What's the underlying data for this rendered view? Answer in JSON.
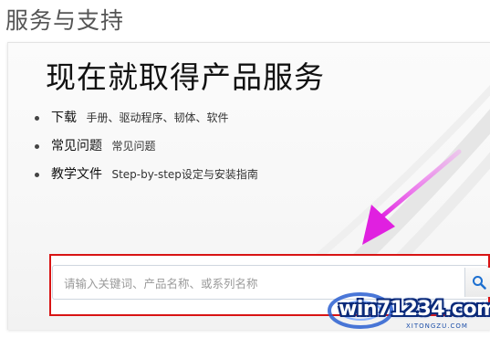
{
  "page": {
    "title": "服务与支持"
  },
  "hero": {
    "heading": "现在就取得产品服务"
  },
  "features": [
    {
      "title": "下载",
      "desc": "手册、驱动程序、韧体、软件"
    },
    {
      "title": "常见问题",
      "desc": "常见问题"
    },
    {
      "title": "教学文件",
      "desc": "Step-by-step设定与安装指南"
    }
  ],
  "search": {
    "placeholder": "请输入关键词、产品名称、或系列名称",
    "button_icon": "search-icon"
  },
  "annotation": {
    "arrow_color": "#e83ee8",
    "frame_color": "#d81414"
  },
  "watermark": {
    "text": "win71234.com",
    "small_text": "XITONGZU.COM"
  }
}
